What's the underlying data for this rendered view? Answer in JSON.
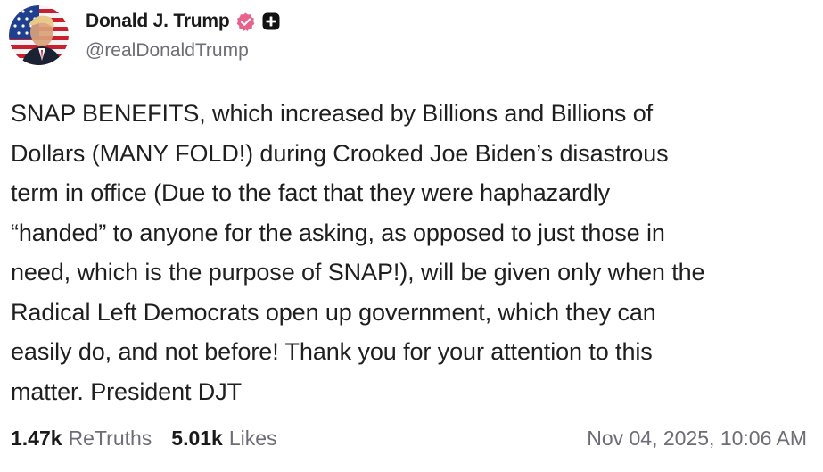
{
  "author": {
    "name": "Donald J. Trump",
    "handle": "@realDonaldTrump",
    "verified_icon": "verified-badge-icon",
    "plus_icon": "plus-square-icon",
    "badge_color": "#e8628b"
  },
  "post": {
    "text": "SNAP BENEFITS, which increased by Billions and Billions of\nDollars (MANY FOLD!) during Crooked Joe Biden’s disastrous\nterm in office (Due to the fact that they were haphazardly\n“handed” to anyone for the asking, as opposed to just those in\nneed, which is the purpose of SNAP!), will be given only when the\nRadical Left Democrats open up government, which they can\neasily do, and not before! Thank you for your attention to this\nmatter. President DJT"
  },
  "stats": {
    "retruths_count": "1.47k",
    "retruths_label": "ReTruths",
    "likes_count": "5.01k",
    "likes_label": "Likes"
  },
  "timestamp": "Nov 04, 2025, 10:06 AM"
}
